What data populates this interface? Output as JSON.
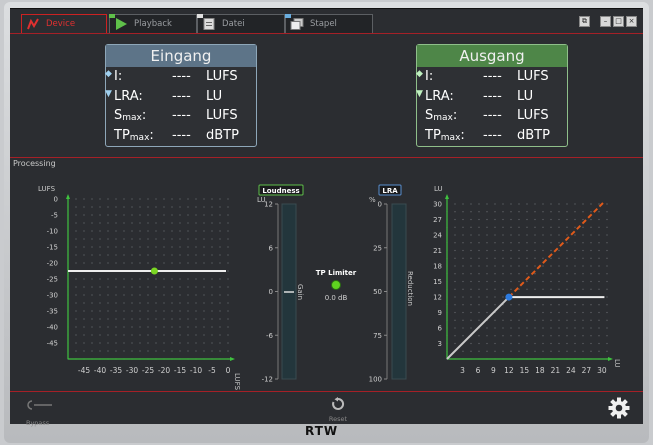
{
  "tabs": [
    {
      "label": "Device",
      "active": true
    },
    {
      "label": "Playback",
      "active": false
    },
    {
      "label": "Datei",
      "active": false
    },
    {
      "label": "Stapel",
      "active": false
    }
  ],
  "input": {
    "title": "Eingang",
    "rows": [
      {
        "label": "I:",
        "value": "----",
        "unit": "LUFS"
      },
      {
        "label": "LRA:",
        "value": "----",
        "unit": "LU"
      },
      {
        "label": "S",
        "sub": "max",
        "suffix": ":",
        "value": "----",
        "unit": "LUFS"
      },
      {
        "label": "TP",
        "sub": "max",
        "suffix": ":",
        "value": "----",
        "unit": "dBTP"
      }
    ]
  },
  "output": {
    "title": "Ausgang",
    "rows": [
      {
        "label": "I:",
        "value": "----",
        "unit": "LUFS"
      },
      {
        "label": "LRA:",
        "value": "----",
        "unit": "LU"
      },
      {
        "label": "S",
        "sub": "max",
        "suffix": ":",
        "value": "----",
        "unit": "LUFS"
      },
      {
        "label": "TP",
        "sub": "max",
        "suffix": ":",
        "value": "----",
        "unit": "dBTP"
      }
    ]
  },
  "processing": {
    "label": "Processing",
    "loudness_graph": {
      "y_unit": "LUFS",
      "x_unit": "LUFS",
      "y_ticks": [
        "0",
        "-5",
        "-10",
        "-15",
        "-20",
        "-25",
        "-30",
        "-35",
        "-40",
        "-45"
      ],
      "x_ticks": [
        "-45",
        "-40",
        "-35",
        "-30",
        "-25",
        "-20",
        "-15",
        "-10",
        "-5",
        "0"
      ],
      "target_level": -22.5,
      "point": {
        "x": -23,
        "y": -22.5
      }
    },
    "loudness_meter": {
      "title": "Loudness",
      "unit": "LU",
      "ticks": [
        "12",
        "6",
        "0",
        "-6",
        "-12"
      ],
      "side_label": "Gain"
    },
    "tp_limiter": {
      "label": "TP Limiter",
      "value": "0.0 dB"
    },
    "lra_meter": {
      "title": "LRA",
      "unit": "%",
      "ticks": [
        "0",
        "25",
        "50",
        "75",
        "100"
      ],
      "side_label": "Reduction"
    },
    "lra_graph": {
      "y_unit": "LU",
      "x_unit": "LU",
      "y_ticks": [
        "30",
        "27",
        "24",
        "21",
        "18",
        "15",
        "12",
        "9",
        "6",
        "3"
      ],
      "x_ticks": [
        "3",
        "6",
        "9",
        "12",
        "15",
        "18",
        "21",
        "24",
        "27",
        "30"
      ],
      "knee": 12
    }
  },
  "bottom": {
    "bypass_label": "Bypass",
    "reset_label": "Reset"
  },
  "brand": "RTW",
  "colors": {
    "accent_red": "#a52027",
    "input_blue": "#5d7488",
    "output_green": "#4e8648",
    "point_green": "#7bd623",
    "point_blue": "#2d7be0",
    "dashed_orange": "#e05a1a"
  }
}
